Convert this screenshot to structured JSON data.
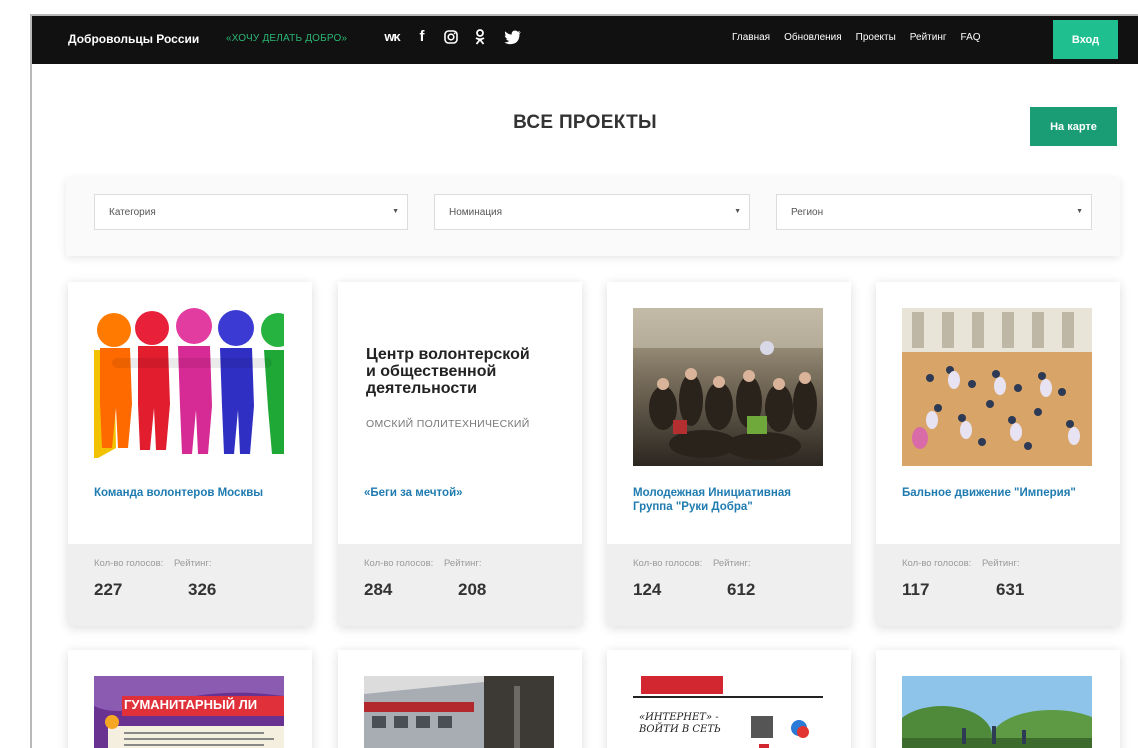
{
  "header": {
    "brand": "Добровольцы России",
    "slogan": "«ХОЧУ ДЕЛАТЬ ДОБРО»",
    "socials": [
      {
        "icon": "vk-icon",
        "glyph": "ᴡᴋ"
      },
      {
        "icon": "facebook-icon",
        "glyph": "f"
      },
      {
        "icon": "instagram-icon",
        "glyph": ""
      },
      {
        "icon": "odnoklassniki-icon",
        "glyph": ""
      },
      {
        "icon": "twitter-icon",
        "glyph": ""
      }
    ],
    "nav": [
      "Главная",
      "Обновления",
      "Проекты",
      "Рейтинг",
      "FAQ"
    ],
    "login_label": "Вход"
  },
  "main": {
    "title": "ВСЕ ПРОЕКТЫ",
    "map_button": "На карте"
  },
  "filters": {
    "category": "Категория",
    "nomination": "Номинация",
    "region": "Регион"
  },
  "stat_labels": {
    "votes": "Кол-во голосов:",
    "rating": "Рейтинг:"
  },
  "projects": [
    {
      "title": "Команда волонтеров Москвы",
      "votes": "227",
      "rating": "326"
    },
    {
      "title": "«Беги за мечтой»",
      "votes": "284",
      "rating": "208"
    },
    {
      "title": "Молодежная Инициативная Группа \"Руки Добра\"",
      "votes": "124",
      "rating": "612"
    },
    {
      "title": "Бальное движение \"Империя\"",
      "votes": "117",
      "rating": "631"
    }
  ],
  "card_images": {
    "logo_lines": [
      "Центр волонтерской",
      "и общественной",
      "деятельности"
    ],
    "logo_sub": "ОМСКИЙ ПОЛИТЕХНИЧЕСКИЙ",
    "humanitarian_banner": "ГУМАНИТАРНЫЙ ЛИ",
    "newspaper_text": "«ИНТЕРНЕТ» - ВОЙТИ В СЕТЬ"
  },
  "colors": {
    "navbar": "#111111",
    "accent_green": "#1fbf8f",
    "map_button": "#1a9d74",
    "slogan": "#2bb673",
    "title_link": "#1f7bb0"
  }
}
